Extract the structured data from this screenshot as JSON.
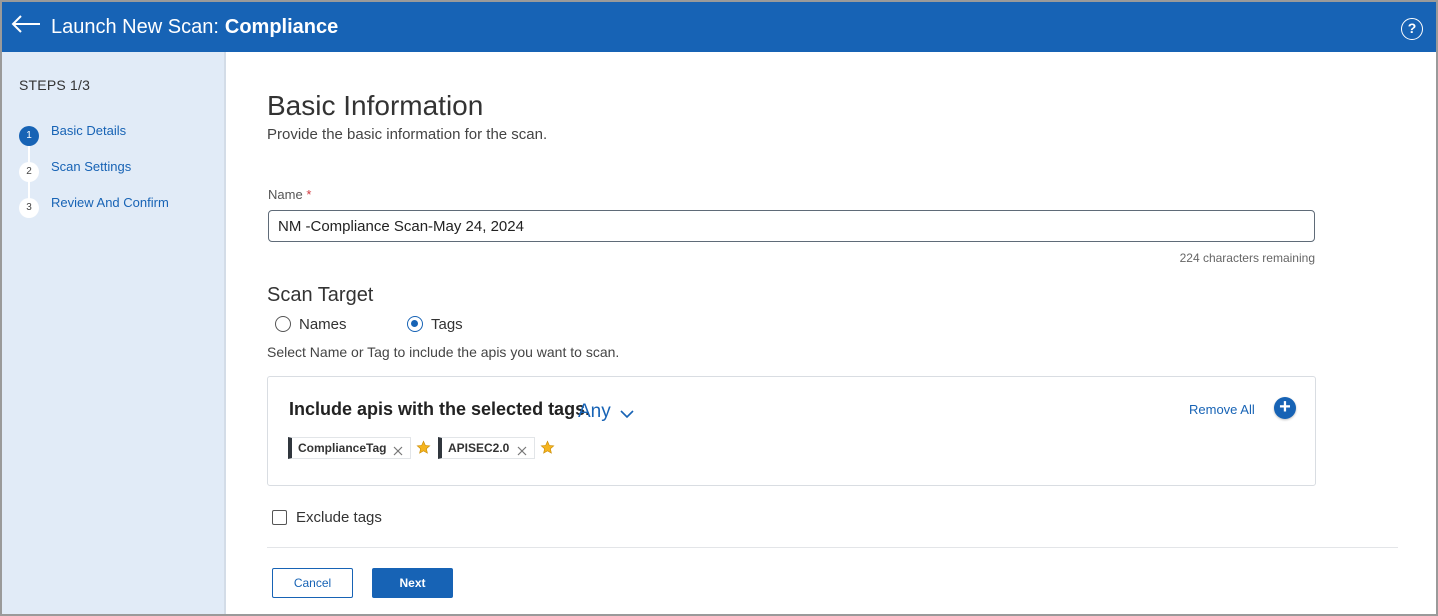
{
  "header": {
    "back_icon": "arrow-left-icon",
    "title_prefix": "Launch New Scan:",
    "title_bold": "Compliance",
    "help_icon": "question-circle-icon",
    "help_glyph": "?"
  },
  "sidebar": {
    "steps_title": "STEPS 1/3",
    "steps": [
      {
        "num": "1",
        "label": "Basic Details",
        "active": true
      },
      {
        "num": "2",
        "label": "Scan Settings",
        "active": false
      },
      {
        "num": "3",
        "label": "Review And Confirm",
        "active": false
      }
    ]
  },
  "main": {
    "heading": "Basic Information",
    "subheading": "Provide the basic information for the scan.",
    "name_label": "Name",
    "required_mark": "*",
    "name_value": "NM -Compliance Scan-May 24, 2024",
    "chars_remaining": "224 characters remaining",
    "scan_target_heading": "Scan Target",
    "radio_options": [
      {
        "label": "Names",
        "selected": false
      },
      {
        "label": "Tags",
        "selected": true
      }
    ],
    "scan_target_hint": "Select Name or Tag to include the apis you want to scan.",
    "tags_box": {
      "title": "Include apis with the selected tags.",
      "match_mode": "Any",
      "remove_all": "Remove All",
      "add_icon": "plus-circle-icon",
      "add_glyph": "+",
      "tags": [
        {
          "label": "ComplianceTag",
          "remove_icon": "close-icon",
          "star_icon": "star-icon"
        },
        {
          "label": "APISEC2.0",
          "remove_icon": "close-icon",
          "star_icon": "star-icon"
        }
      ]
    },
    "exclude_tags_label": "Exclude tags",
    "exclude_tags_checked": false
  },
  "footer": {
    "cancel_label": "Cancel",
    "next_label": "Next"
  },
  "colors": {
    "primary": "#1763b5",
    "sidebar_bg": "#e1ebf7",
    "star": "#f5b41e",
    "required": "#d0393e"
  }
}
